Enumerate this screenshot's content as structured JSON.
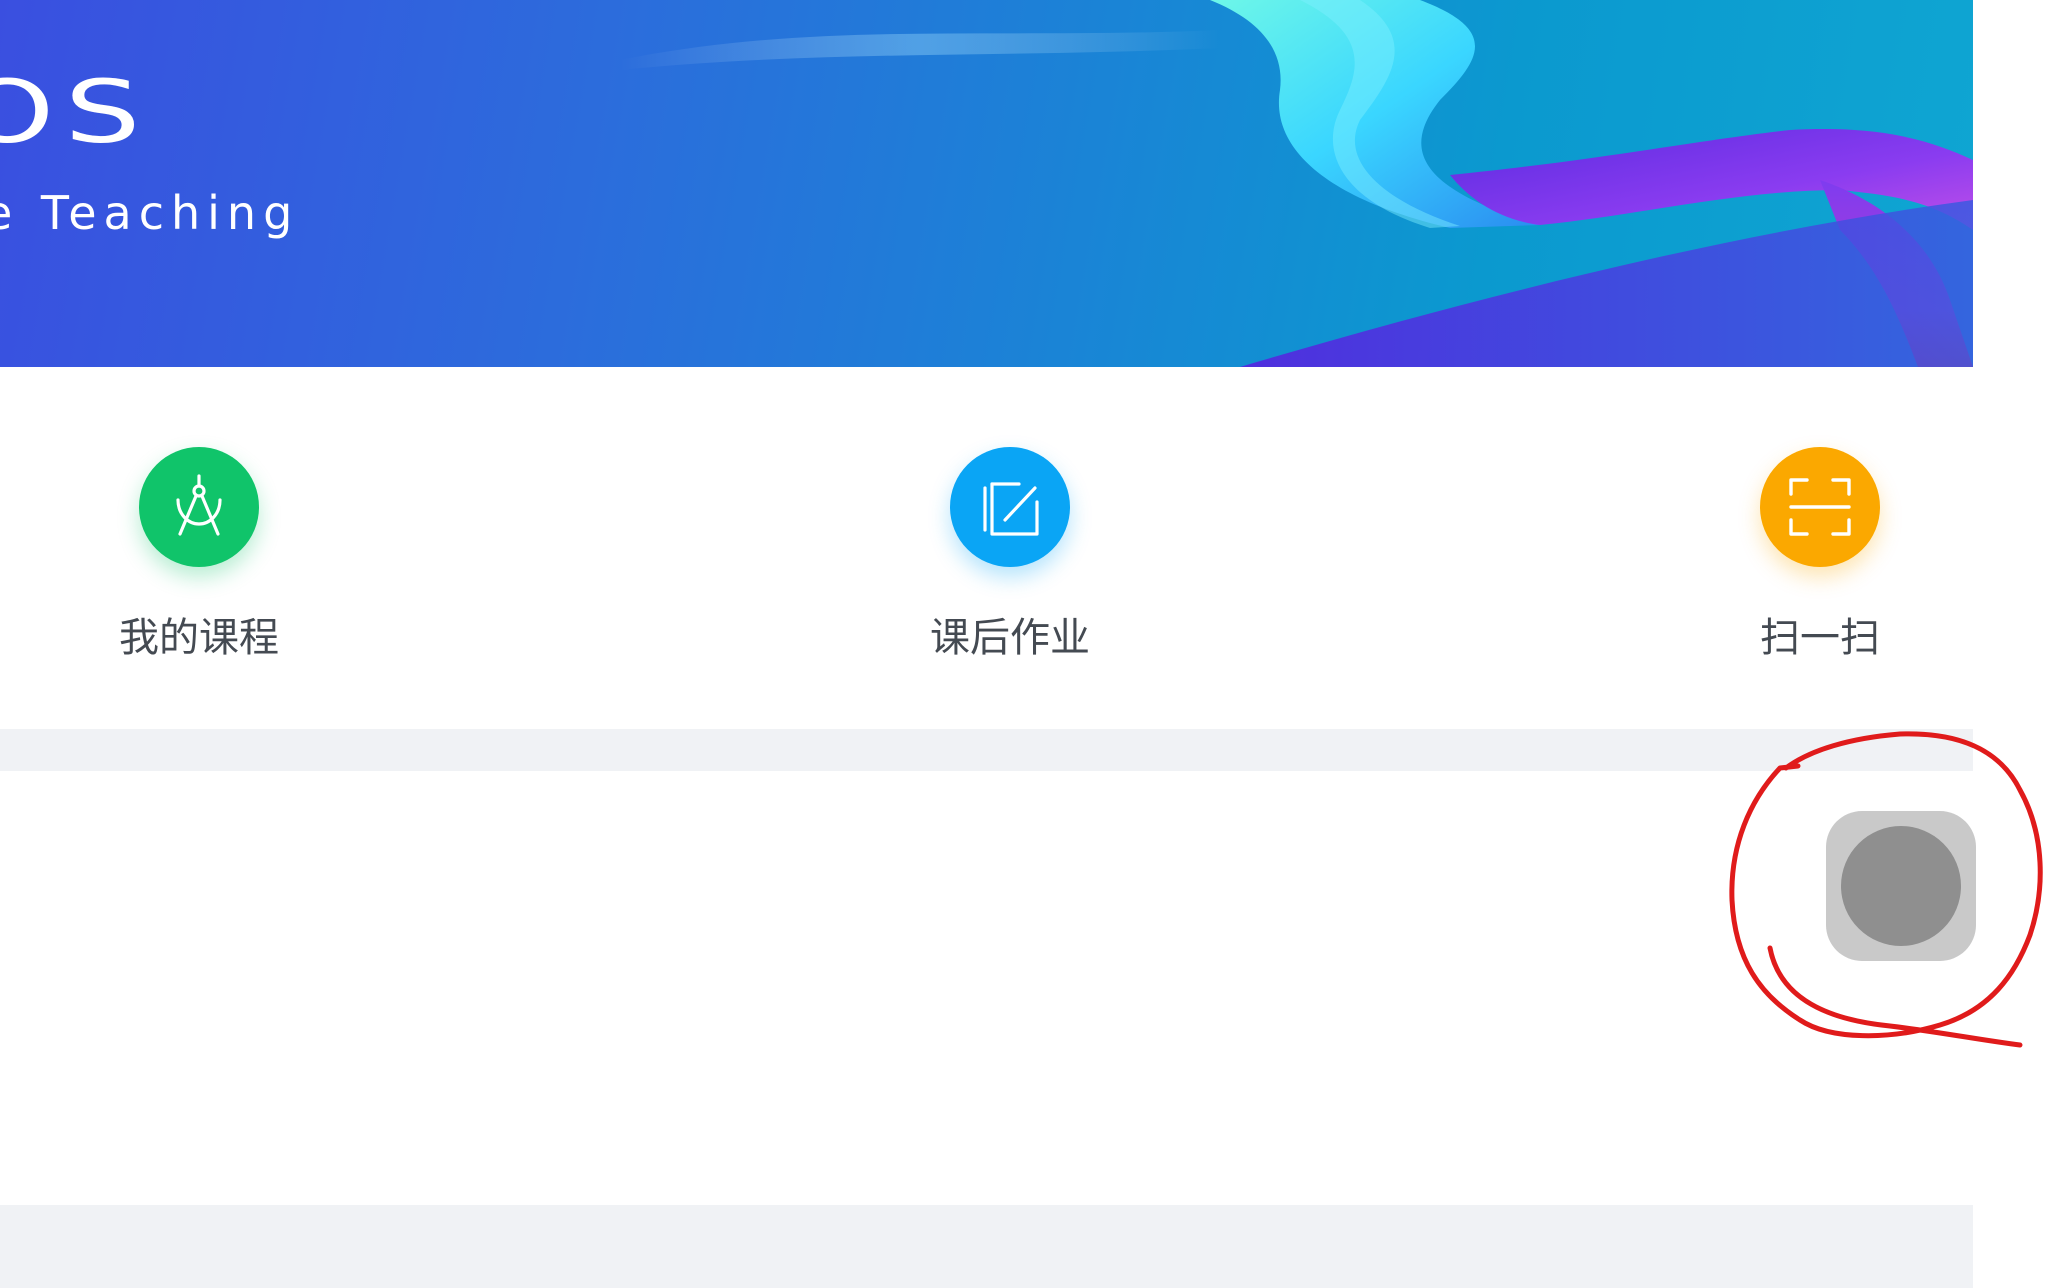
{
  "banner": {
    "logo_text": "OS",
    "tagline": "e Teaching"
  },
  "quick_actions": [
    {
      "label": "我的课程",
      "icon": "compass-icon",
      "color": "#10c46a"
    },
    {
      "label": "课后作业",
      "icon": "edit-icon",
      "color": "#0aa5f5"
    },
    {
      "label": "扫一扫",
      "icon": "scan-icon",
      "color": "#fba800"
    }
  ],
  "colors": {
    "page_background": "#ffffff",
    "divider": "#f0f2f5",
    "float_button_outer": "#c9c9c9",
    "float_button_inner": "#8f8f8f",
    "annotation": "#e01b1b"
  },
  "float_button": {
    "icon": "assistive-touch-icon"
  }
}
